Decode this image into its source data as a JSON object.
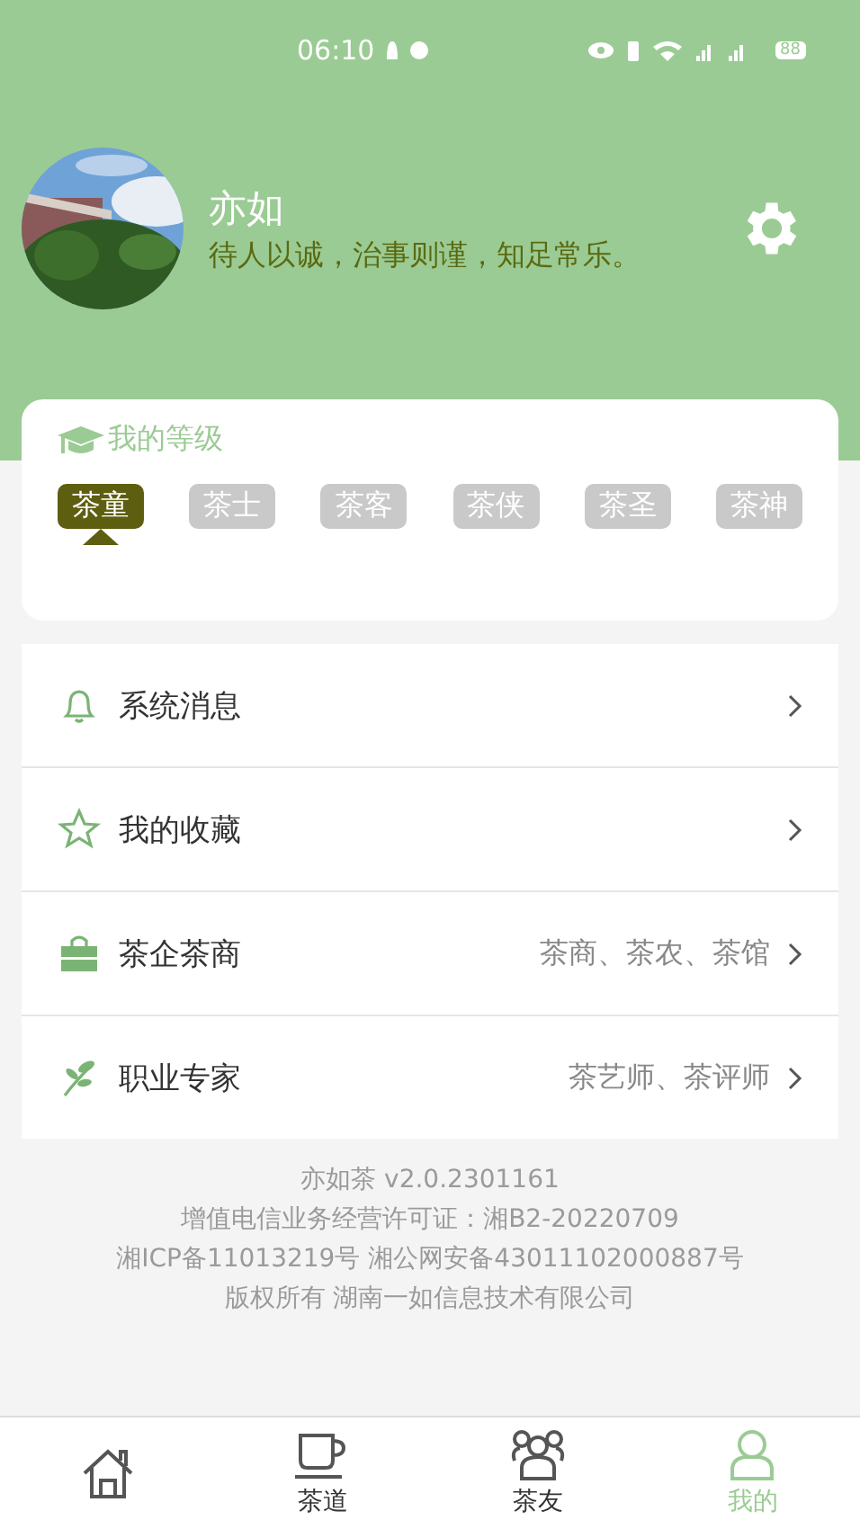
{
  "status_bar": {
    "time": "06:10",
    "battery": "88"
  },
  "profile": {
    "name": "亦如",
    "motto": "待人以诚，治事则谨，知足常乐。"
  },
  "level_card": {
    "title": "我的等级",
    "levels": [
      {
        "label": "茶童",
        "selected": true
      },
      {
        "label": "茶士",
        "selected": false
      },
      {
        "label": "茶客",
        "selected": false
      },
      {
        "label": "茶侠",
        "selected": false
      },
      {
        "label": "茶圣",
        "selected": false
      },
      {
        "label": "茶神",
        "selected": false
      }
    ]
  },
  "menu": [
    {
      "kind": "bell",
      "label": "系统消息"
    },
    {
      "kind": "star",
      "label": "我的收藏"
    },
    {
      "kind": "bag",
      "label": "茶企茶商",
      "detail": "茶商、茶农、茶馆"
    },
    {
      "kind": "leaf",
      "label": "职业专家",
      "detail": "茶艺师、茶评师"
    }
  ],
  "footer": [
    "亦如茶 v2.0.2301161",
    "增值电信业务经营许可证：湘B2-20220709",
    "湘ICP备11013219号 湘公网安备43011102000887号",
    "版权所有 湖南一如信息技术有限公司"
  ],
  "tabs": [
    {
      "kind": "home",
      "selected": false
    },
    {
      "kind": "cup",
      "label": "茶道",
      "selected": false
    },
    {
      "kind": "friends",
      "label": "茶友",
      "selected": false
    },
    {
      "kind": "person",
      "label": "我的",
      "selected": true
    }
  ]
}
